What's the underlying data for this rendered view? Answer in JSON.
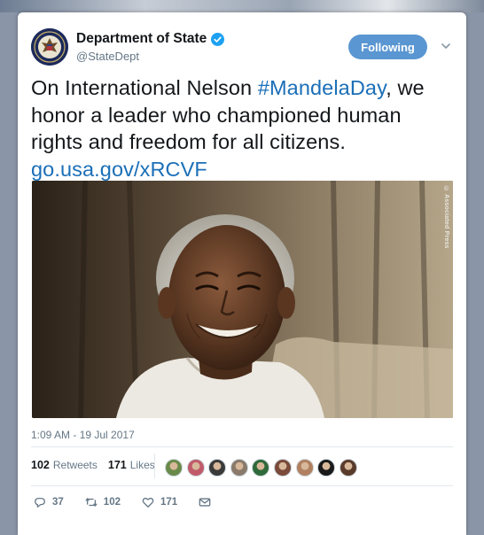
{
  "account": {
    "display_name": "Department of State",
    "handle": "@StateDept",
    "verified_icon": "verified-badge-icon",
    "avatar_icon": "state-department-seal-icon"
  },
  "follow_button": {
    "label": "Following"
  },
  "tweet": {
    "text_before_hashtag": "On International Nelson ",
    "hashtag": "#MandelaDay",
    "text_after_hashtag": ", we honor a leader who championed human rights and freedom for all citizens. ",
    "link": "go.usa.gov/xRCVF"
  },
  "photo": {
    "credit": "© Associated Press"
  },
  "timestamp": "1:09 AM - 19 Jul 2017",
  "stats": {
    "retweets_count": "102",
    "retweets_label": "Retweets",
    "likes_count": "171",
    "likes_label": "Likes"
  },
  "likers": [
    "#6a8a4a",
    "#c05a6a",
    "#3a3a3a",
    "#8a7a6a",
    "#2f6a3a",
    "#7a4a3a",
    "#b08060",
    "#1a1a1a",
    "#5a3a2a"
  ],
  "actions": {
    "replies": "37",
    "retweets": "102",
    "likes": "171"
  },
  "colors": {
    "link": "#1b6fb8",
    "follow_button": "#5a96d1",
    "muted": "#657786"
  }
}
